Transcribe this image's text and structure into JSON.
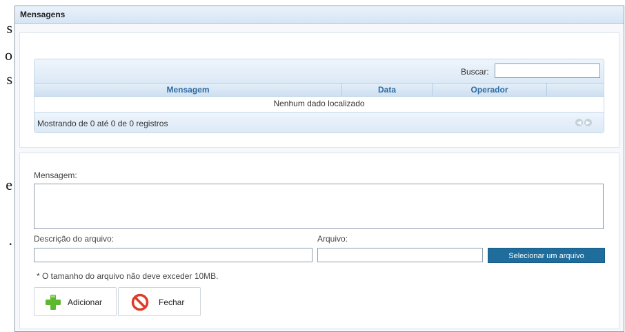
{
  "background": {
    "letters": [
      "s",
      "o",
      "s",
      "e",
      "."
    ]
  },
  "dialog": {
    "title": "Mensagens"
  },
  "grid": {
    "search_label": "Buscar:",
    "search_value": "",
    "columns": [
      "Mensagem",
      "Data",
      "Operador",
      ""
    ],
    "empty_text": "Nenhum dado localizado",
    "info_text": "Mostrando de 0 até 0 de 0 registros",
    "pager_icons": [
      "prev-page-icon",
      "next-page-icon"
    ]
  },
  "form": {
    "message_label": "Mensagem:",
    "message_value": "",
    "file_desc_label": "Descrição do arquivo:",
    "file_desc_value": "",
    "file_label": "Arquivo:",
    "file_value": "",
    "select_file_label": "Selecionar um arquivo",
    "size_note": "* O tamanho do arquivo não deve exceder 10MB.",
    "add_label": "Adicionar",
    "close_label": "Fechar"
  },
  "colors": {
    "accent": "#1f6d9c",
    "header_text": "#2d6ca2",
    "add_icon": "#5cb82e",
    "close_icon": "#e03a28"
  }
}
